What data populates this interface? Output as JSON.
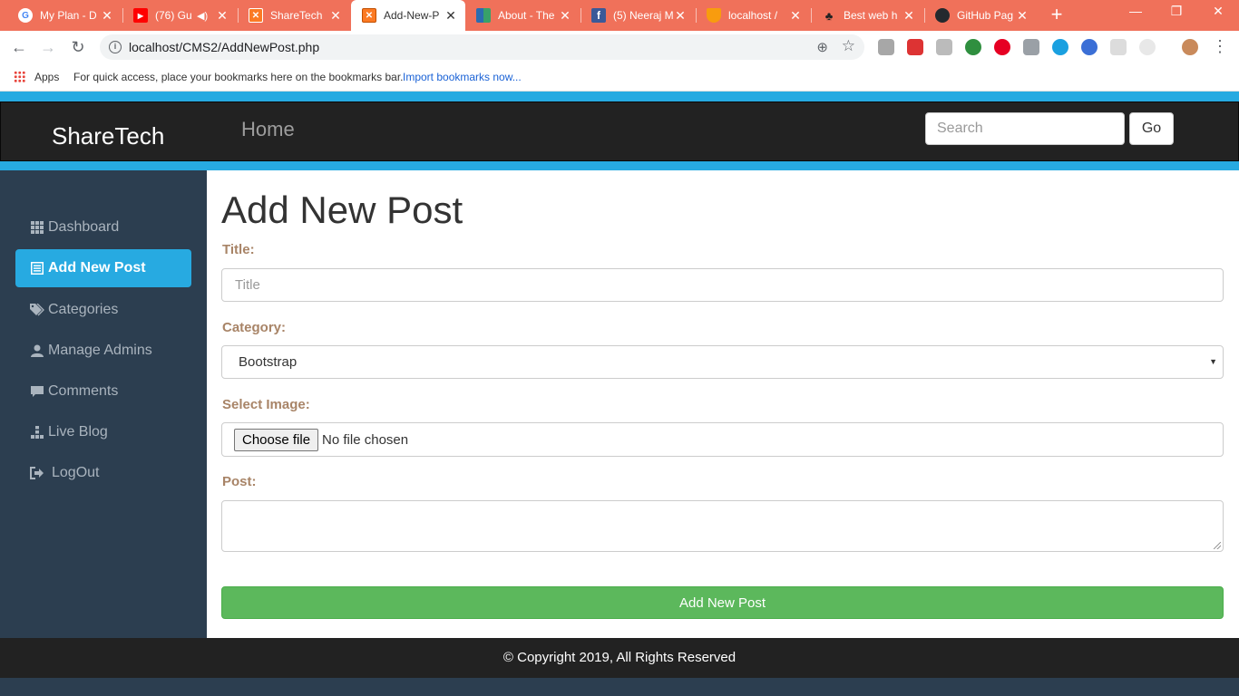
{
  "browser": {
    "tabs": [
      {
        "title": "My Plan - D",
        "icon": "google-icon",
        "color": "#4285f4",
        "glyph": "G"
      },
      {
        "title": "(76) Gu",
        "icon": "youtube-icon",
        "color": "#ff0000",
        "glyph": "▶"
      },
      {
        "title": "ShareTech",
        "icon": "xampp-icon",
        "color": "#fb7a24",
        "glyph": "⊠"
      },
      {
        "title": "Add-New-P",
        "icon": "xampp-icon",
        "color": "#fb7a24",
        "glyph": "⊠"
      },
      {
        "title": "About - The",
        "icon": "grid-icon",
        "color": "#2e8b57",
        "glyph": "▦"
      },
      {
        "title": "(5) Neeraj M",
        "icon": "facebook-icon",
        "color": "#3b5998",
        "glyph": "f"
      },
      {
        "title": "localhost /",
        "icon": "phpmyadmin-icon",
        "color": "#f89c0e",
        "glyph": "⛵"
      },
      {
        "title": "Best web h",
        "icon": "paw-icon",
        "color": "#333333",
        "glyph": "🐾"
      },
      {
        "title": "GitHub Pag",
        "icon": "github-icon",
        "color": "#24292e",
        "glyph": "●"
      }
    ],
    "url": "localhost/CMS2/AddNewPost.php",
    "bookmarks": {
      "apps_label": "Apps",
      "message": "For quick access, place your bookmarks here on the bookmarks bar.",
      "import_link": "Import bookmarks now..."
    },
    "tab_strip_color": "#f0715a"
  },
  "navbar": {
    "brand": "ShareTech",
    "home_link": "Home",
    "search_placeholder": "Search",
    "go_label": "Go",
    "accent_color": "#27aae1"
  },
  "sidebar": {
    "items": [
      {
        "label": "Dashboard",
        "icon": "dashboard-icon",
        "active": false
      },
      {
        "label": "Add New Post",
        "icon": "list-icon",
        "active": true
      },
      {
        "label": "Categories",
        "icon": "tags-icon",
        "active": false
      },
      {
        "label": "Manage Admins",
        "icon": "user-icon",
        "active": false
      },
      {
        "label": "Comments",
        "icon": "comment-icon",
        "active": false
      },
      {
        "label": "Live Blog",
        "icon": "tree-icon",
        "active": false
      },
      {
        "label": "LogOut",
        "icon": "logout-icon",
        "active": false
      }
    ]
  },
  "form": {
    "page_title": "Add New Post",
    "title_label": "Title:",
    "title_placeholder": "Title",
    "category_label": "Category:",
    "category_value": "Bootstrap",
    "image_label": "Select Image:",
    "choose_file_label": "Choose file",
    "no_file_text": "No file chosen",
    "post_label": "Post:",
    "submit_label": "Add New Post",
    "label_color": "#a88467",
    "submit_color": "#5cb85c"
  },
  "footer": {
    "copyright": "© Copyright 2019, All Rights Reserved"
  }
}
